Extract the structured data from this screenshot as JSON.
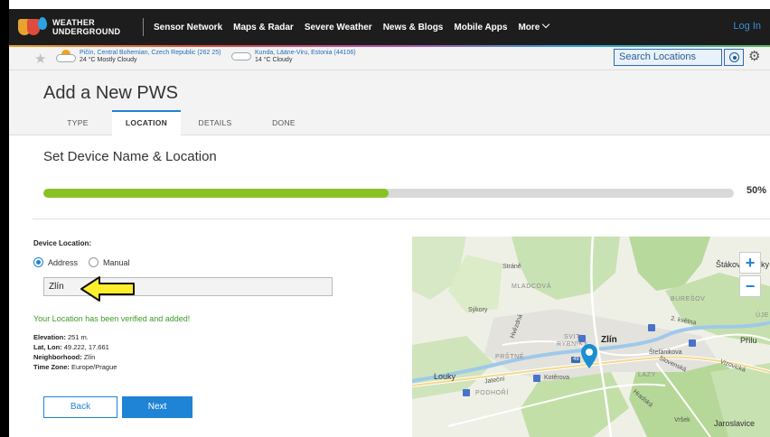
{
  "nav": {
    "logo_line1": "WEATHER",
    "logo_line2": "UNDERGROUND",
    "items": [
      "Sensor Network",
      "Maps & Radar",
      "Severe Weather",
      "News & Blogs",
      "Mobile Apps",
      "More"
    ],
    "login": "Log In"
  },
  "locations": [
    {
      "place": "Pičín, Central Bohemian, Czech Republic (262 25)",
      "cond": "24 °C Mostly Cloudy",
      "icon": "partly-cloudy-icon"
    },
    {
      "place": "Kunda, Lääne-Viru, Estonia (44106)",
      "cond": "14 °C Cloudy",
      "icon": "cloudy-icon"
    }
  ],
  "search": {
    "placeholder": "Search Locations"
  },
  "page": {
    "title": "Add a New PWS",
    "tabs": [
      "TYPE",
      "LOCATION",
      "DETAILS",
      "DONE"
    ],
    "active_tab": "LOCATION"
  },
  "section": {
    "title": "Set Device Name & Location",
    "progress_percent": 50,
    "progress_text": "50%"
  },
  "form": {
    "device_location_label": "Device Location:",
    "radio_address": "Address",
    "radio_manual": "Manual",
    "address_value": "Zlín",
    "verified_msg": "Your Location has been verified and added!",
    "elevation_label": "Elevation:",
    "elevation_value": "251 m.",
    "latlon_label": "Lat, Lon:",
    "latlon_value": "49.222, 17.661",
    "neighborhood_label": "Neighborhood:",
    "neighborhood_value": "Zlín",
    "timezone_label": "Time Zone:",
    "timezone_value": "Europe/Prague",
    "back": "Back",
    "next": "Next"
  },
  "map": {
    "zoom_in": "+",
    "zoom_out": "−",
    "labels": {
      "strane": "Stráně",
      "stakov": "Štákov",
      "ky": "ky",
      "mladcova": "MLADCOVÁ",
      "buresov": "BUREŠOV",
      "sykory": "Sýkory",
      "kvetna": "2. května",
      "uje": "ÚJE",
      "svit": "SVIT-",
      "rybniky": "RYBNÍKY",
      "zlin": "Zlín",
      "stefanikova": "Štefánikova",
      "prilu": "Přílu",
      "prstne": "PRŠTNÉ",
      "vizovicka": "Vizovická",
      "louky": "Louky",
      "jateni": "Jateční",
      "koterova": "Kotěrova",
      "lazy": "LAZY",
      "podhori": "PODHOŘÍ",
      "vrsek": "Vršek",
      "jaroslavice": "Jaroslavice",
      "hvezdna": "Hvězdná",
      "slovenska": "Slovenská",
      "hradska": "Hradská",
      "road49": "49"
    }
  },
  "colors": {
    "accent": "#1f84d6",
    "progress": "#8ac226",
    "verified": "#3e9a2a",
    "nav_bg": "#1d1d1d"
  }
}
